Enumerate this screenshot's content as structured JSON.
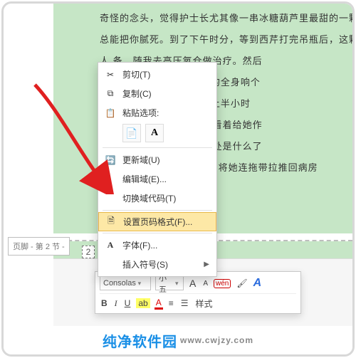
{
  "doc_lines": [
    "奇怪的念头，觉得护士长尤其像一串冰糖葫芦里最甜的一颗",
    "总能把你腻死。到了下午时分，等到西芹打完吊瓶后，这颗糖",
    "人                                                     备，随我去高压氧仓做治疗。然后",
    "一                                                     有押送\"重犯\"才会用到的全身响个",
    "棒                                                     钻进去的\"救生仓\"里闷上半小时",
    "但                                                 ，有一次当西芹不解地看着给她作",
    "护                                             ，西芹终于明白这种好处是什么了",
    "轮椅\"再次将她连拖带拉推回病房"
  ],
  "footer_label": "页脚 - 第 2 节 -",
  "page_number": "2",
  "menu": {
    "cut": "剪切(T)",
    "copy": "复制(C)",
    "paste_label": "粘贴选项:",
    "update_field": "更新域(U)",
    "edit_field": "编辑域(E)...",
    "toggle_codes": "切换域代码(T)",
    "page_format": "设置页码格式(F)...",
    "font": "字体(F)...",
    "insert_symbol": "插入符号(S)"
  },
  "mini": {
    "font": "Consolas",
    "size": "小五",
    "grow": "A",
    "shrink": "A",
    "wen": "wén",
    "styles": "样式",
    "bold": "B",
    "italic": "I",
    "underline": "U"
  },
  "logo_main": "纯净软件园",
  "logo_url": "www.cwjzy.com"
}
